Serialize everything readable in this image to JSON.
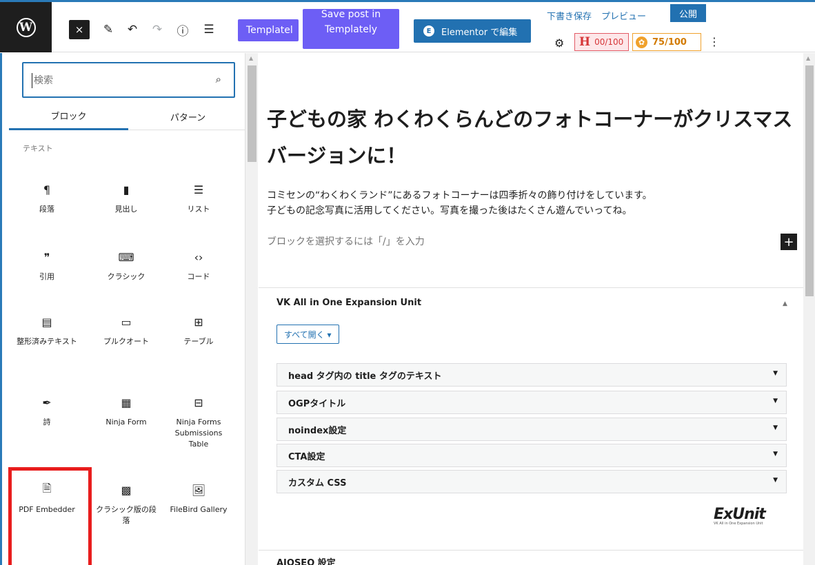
{
  "toolbar": {
    "logo_icon": "wordpress-icon",
    "close_icon": "×",
    "pencil_icon": "✎",
    "undo_icon": "↶",
    "redo_icon": "↷",
    "info_icon": "ⓘ",
    "outline_icon": "☰",
    "templately_label": "Templatel",
    "save_templately_line1": "Save post in",
    "save_templately_line2": "Templately",
    "elementor_label": "Elementor で編集",
    "elementor_icon": "E",
    "draft_label": "下書き保存",
    "preview_label": "プレビュー",
    "publish_label": "公開",
    "gear_icon": "⚙",
    "h_score_letter": "H",
    "h_score": "00/100",
    "seo_score": "75/100",
    "kebab_icon": "⋮",
    "accent": "#2271b1",
    "templately_color": "#6d5ef5"
  },
  "inserter": {
    "search_placeholder": "検索",
    "search_icon": "⌕",
    "tabs": [
      "ブロック",
      "パターン"
    ],
    "section_label": "テキスト",
    "blocks": [
      {
        "icon": "¶",
        "label": "段落"
      },
      {
        "icon": "▮",
        "label": "見出し"
      },
      {
        "icon": "☰",
        "label": "リスト"
      },
      {
        "icon": "❞",
        "label": "引用"
      },
      {
        "icon": "⌨",
        "label": "クラシック"
      },
      {
        "icon": "‹›",
        "label": "コード"
      },
      {
        "icon": "▤",
        "label": "整形済みテキスト"
      },
      {
        "icon": "▭",
        "label": "プルクオート"
      },
      {
        "icon": "⊞",
        "label": "テーブル"
      },
      {
        "icon": "✒",
        "label": "詩"
      },
      {
        "icon": "▦",
        "label": "Ninja Form"
      },
      {
        "icon": "⊟",
        "label": "Ninja Forms Submissions Table"
      },
      {
        "icon": "🗎",
        "label": "PDF Embedder"
      },
      {
        "icon": "▩",
        "label": "クラシック版の段落"
      },
      {
        "icon": "🖼",
        "label": "FileBird Gallery"
      }
    ],
    "highlight_color": "#e81d1d"
  },
  "editor": {
    "title": "子どもの家 わくわくらんどのフォトコーナーがクリスマスバージョンに！",
    "paragraph_line1": "コミセンの“わくわくランド”にあるフォトコーナーは四季折々の飾り付けをしています。",
    "paragraph_line2": "子どもの記念写真に活用してください。写真を撮った後はたくさん遊んでいってね。",
    "placeholder": "ブロックを選択するには「/」を入力",
    "add_icon": "+"
  },
  "meta": {
    "heading": "VK All in One Expansion Unit",
    "expand_all": "すべて開く ▾",
    "rows": [
      "head タグ内の title タグのテキスト",
      "OGPタイトル",
      "noindex設定",
      "CTA設定",
      "カスタム CSS"
    ],
    "logo_text": "ExUnit",
    "logo_sub": "VK All in One Expansion Unit",
    "aioseo_heading": "AIOSEO 設定"
  }
}
